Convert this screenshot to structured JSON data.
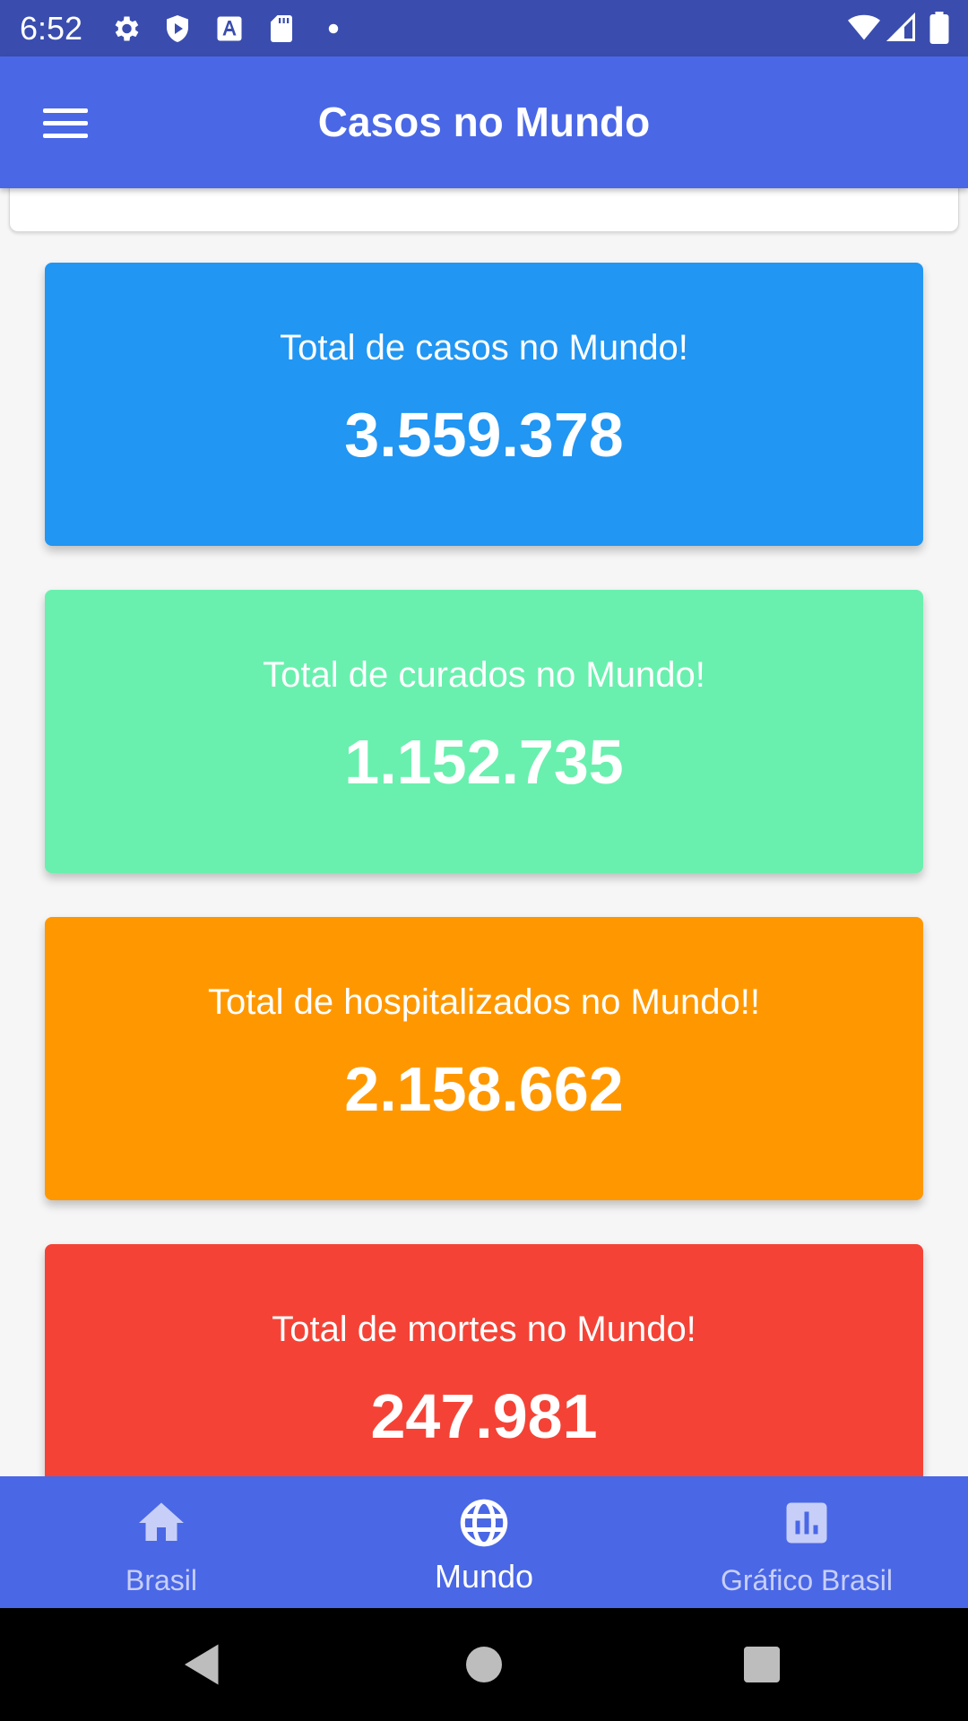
{
  "status_bar": {
    "time": "6:52"
  },
  "app_bar": {
    "title": "Casos no Mundo",
    "menu_icon": "hamburger-menu-icon"
  },
  "cards": [
    {
      "label": "Total de casos no Mundo!",
      "value": "3.559.378",
      "color": "#2196f3"
    },
    {
      "label": "Total de curados no Mundo!",
      "value": "1.152.735",
      "color": "#69f0ae"
    },
    {
      "label": "Total de hospitalizados no Mundo!!",
      "value": "2.158.662",
      "color": "#ff9800"
    },
    {
      "label": "Total de mortes no Mundo!",
      "value": "247.981",
      "color": "#f44336"
    }
  ],
  "bottom_nav": {
    "items": [
      {
        "label": "Brasil",
        "icon": "home-icon",
        "active": false
      },
      {
        "label": "Mundo",
        "icon": "globe-icon",
        "active": true
      },
      {
        "label": "Gráfico Brasil",
        "icon": "bar-chart-icon",
        "active": false
      }
    ]
  },
  "colors": {
    "status_bar": "#3a4dae",
    "primary": "#4a67e6",
    "background": "#f6f6f6"
  }
}
